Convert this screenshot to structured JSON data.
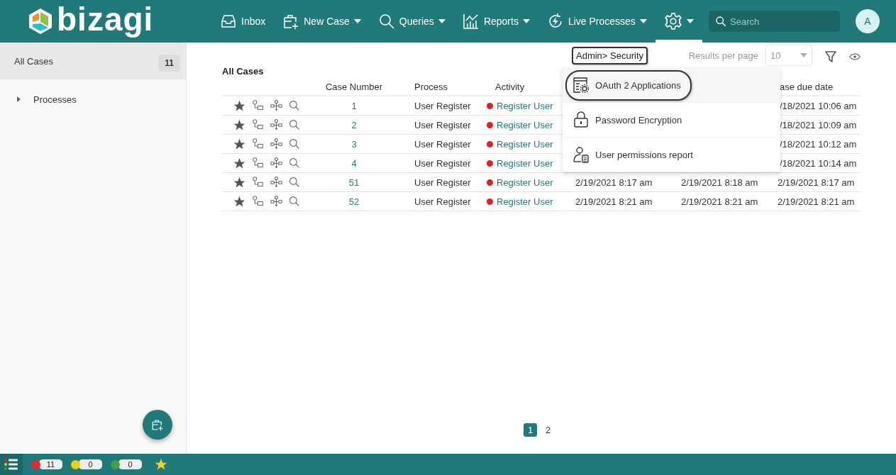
{
  "header": {
    "logo": "bizagi",
    "nav": [
      {
        "label": "Inbox",
        "dropdown": false,
        "selected": false
      },
      {
        "label": "New Case",
        "dropdown": true,
        "selected": false
      },
      {
        "label": "Queries",
        "dropdown": true,
        "selected": false
      },
      {
        "label": "Reports",
        "dropdown": true,
        "selected": false
      },
      {
        "label": "Live Processes",
        "dropdown": true,
        "selected": false
      },
      {
        "dropdown": true,
        "selected": true
      }
    ],
    "search": {
      "placeholder": "Search"
    },
    "avatar": "A"
  },
  "sidebar": {
    "items": [
      {
        "kind": "count",
        "label": "All Cases",
        "count": "11",
        "selected": true
      },
      {
        "kind": "folder",
        "label": "Processes",
        "selected": false
      }
    ]
  },
  "main": {
    "title": "All Cases",
    "results_per_page": {
      "label": "Results per page",
      "value": "10"
    },
    "table": {
      "columns": {
        "case_number": "Case Number",
        "process": "Process",
        "activity": "Activity",
        "due_date": "ase due date"
      },
      "rows": [
        {
          "number": "1",
          "process": "User Register",
          "activity": "Register User",
          "due_date": "/18/2021 10:06 am"
        },
        {
          "number": "2",
          "process": "User Register",
          "activity": "Register User",
          "due_date": "/18/2021 10:09 am"
        },
        {
          "number": "3",
          "process": "User Register",
          "activity": "Register User",
          "due_date": "/18/2021 10:12 am"
        },
        {
          "number": "4",
          "process": "User Register",
          "activity": "Register User",
          "due_date": "/18/2021 10:14 am"
        },
        {
          "number": "51",
          "process": "User Register",
          "activity": "Register User",
          "date_1": "2/19/2021 8:17 am",
          "date_2": "2/19/2021 8:18 am",
          "due_date": "2/19/2021 8:17 am"
        },
        {
          "number": "52",
          "process": "User Register",
          "activity": "Register User",
          "date_1": "2/19/2021 8:21 am",
          "date_2": "2/19/2021 8:21 am",
          "due_date": "2/19/2021 8:21 am"
        }
      ]
    },
    "pagination": [
      {
        "label": "1",
        "selected": true
      },
      {
        "label": "2",
        "selected": false
      }
    ]
  },
  "admin_menu": {
    "breadcrumb": "Admin> Security",
    "items": [
      {
        "label": "OAuth 2 Applications",
        "selected": true
      },
      {
        "label": "Password Encryption",
        "selected": false
      },
      {
        "label": "User permissions report",
        "selected": false
      }
    ]
  },
  "status_bar": {
    "counters": [
      {
        "color": "#e8262b",
        "count": "11"
      },
      {
        "color": "#e6d500",
        "count": "0"
      },
      {
        "color": "#43a047",
        "count": "0"
      }
    ]
  }
}
